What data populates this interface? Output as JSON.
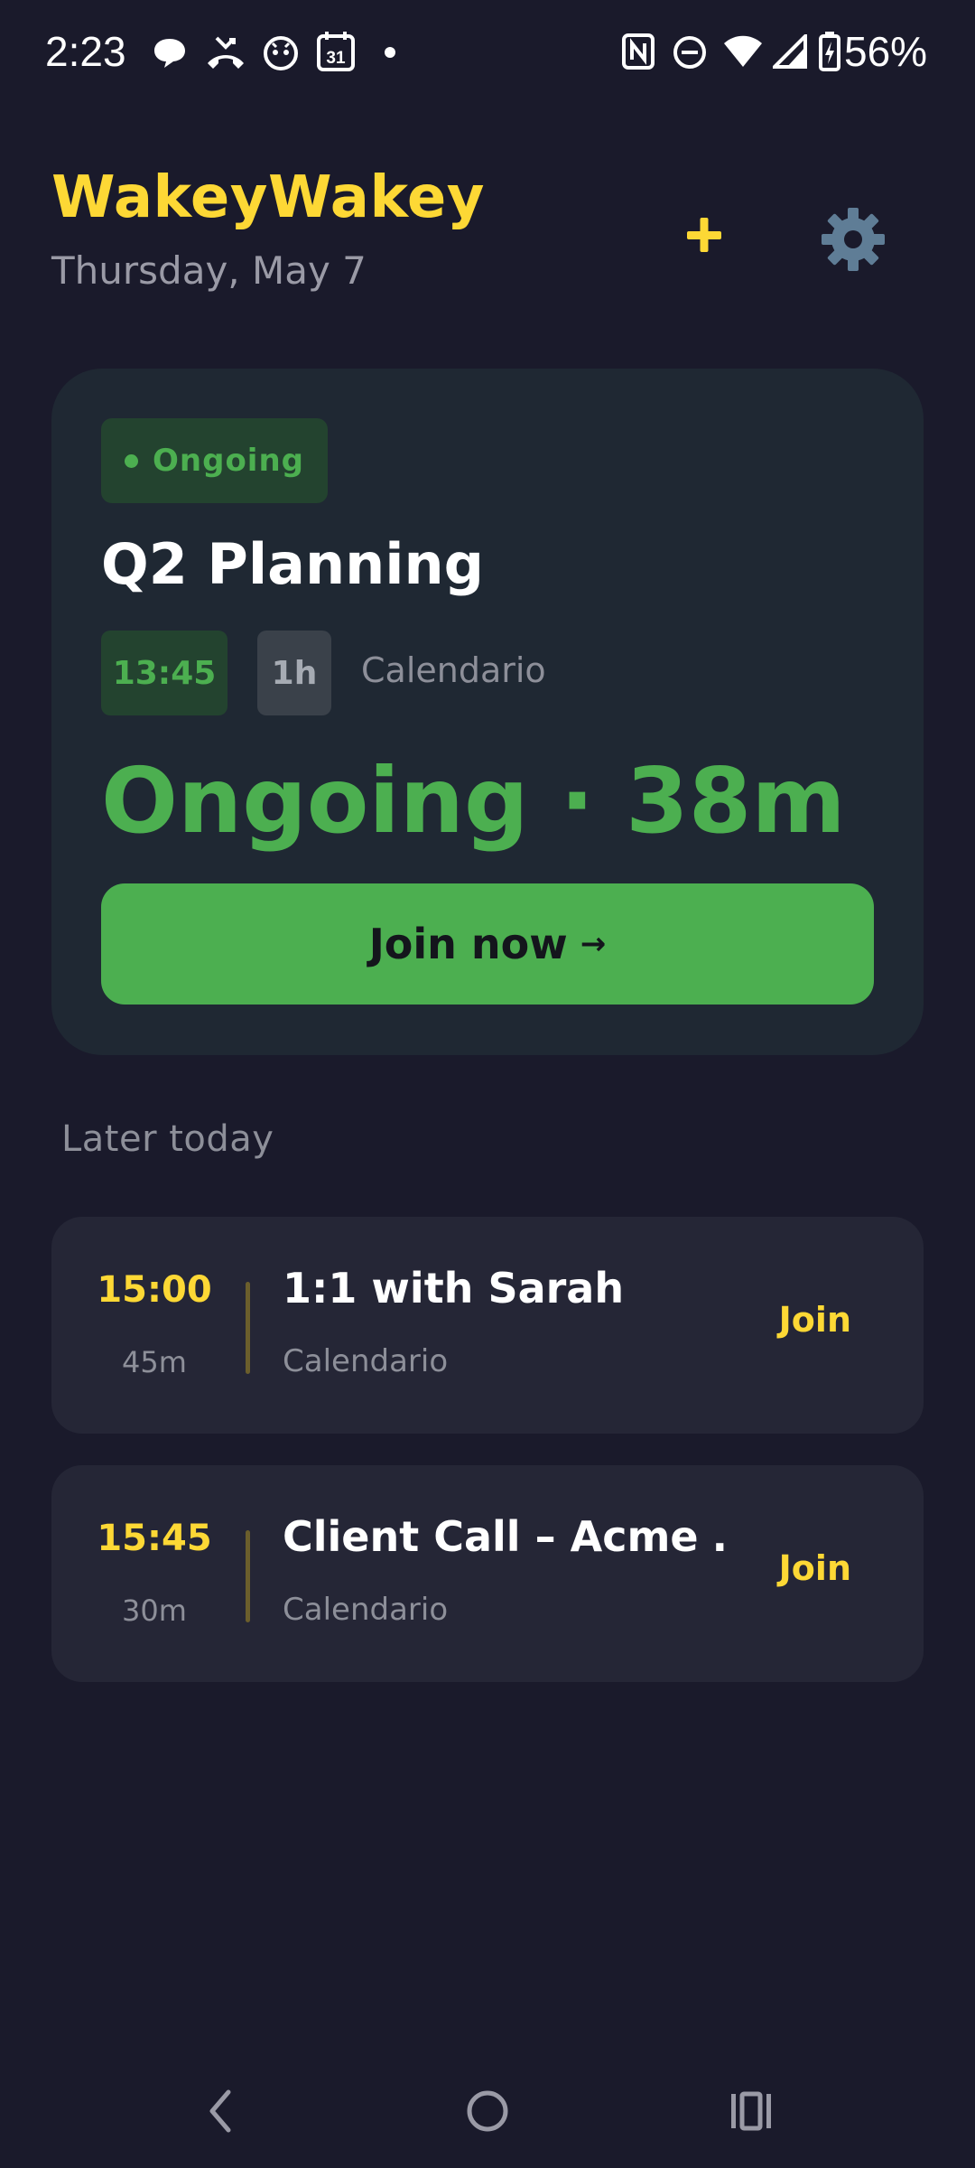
{
  "status_bar": {
    "time": "2:23",
    "battery": "56%",
    "calendar_day": "31",
    "icons": [
      "chat-icon",
      "missed-call-icon",
      "assistant-icon",
      "calendar-icon",
      "notification-dot-icon",
      "nfc-icon",
      "do-not-disturb-icon",
      "wifi-icon",
      "signal-icon",
      "battery-charging-icon"
    ]
  },
  "header": {
    "title": "WakeyWakey",
    "date": "Thursday, May 7",
    "add_icon": "plus-icon",
    "settings_icon": "gear-icon"
  },
  "current": {
    "status_label": "Ongoing",
    "title": "Q2 Planning",
    "start_time": "13:45",
    "duration": "1h",
    "source": "Calendario",
    "big_status": "Ongoing · 38m",
    "join_label": "Join now",
    "join_arrow": "→"
  },
  "later": {
    "section_title": "Later today",
    "items": [
      {
        "time": "15:00",
        "duration": "45m",
        "title": "1:1 with Sarah",
        "source": "Calendario",
        "join_label": "Join"
      },
      {
        "time": "15:45",
        "duration": "30m",
        "title": "Client Call – Acme …",
        "source": "Calendario",
        "join_label": "Join"
      }
    ]
  },
  "navbar": {
    "icons": [
      "back-icon",
      "home-icon",
      "recents-icon"
    ]
  },
  "colors": {
    "background": "#1a1a2b",
    "accent_yellow": "#fdd835",
    "accent_green": "#4caf50",
    "card": "#1f2833",
    "row_card": "#252636",
    "muted_text": "#8d8f99"
  }
}
